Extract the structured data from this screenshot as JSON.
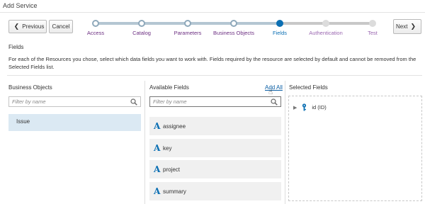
{
  "window": {
    "title": "Add Service"
  },
  "toolbar": {
    "previous_label": "Previous",
    "cancel_label": "Cancel",
    "next_label": "Next"
  },
  "train": {
    "steps": [
      {
        "label": "Access",
        "state": "visited"
      },
      {
        "label": "Catalog",
        "state": "visited"
      },
      {
        "label": "Parameters",
        "state": "visited"
      },
      {
        "label": "Business Objects",
        "state": "visited"
      },
      {
        "label": "Fields",
        "state": "current"
      },
      {
        "label": "Authentication",
        "state": "future"
      },
      {
        "label": "Test",
        "state": "future"
      }
    ]
  },
  "section": {
    "title": "Fields",
    "description": "For each of the Resources you chose, select which data fields you want to work with. Fields required by the resource are selected by default and cannot be removed from the Selected Fields list."
  },
  "business_objects": {
    "label": "Business Objects",
    "filter_placeholder": "Filter by name",
    "items": [
      "Issue"
    ]
  },
  "available_fields": {
    "label": "Available Fields",
    "add_all_label": "Add All",
    "filter_placeholder": "Filter by name",
    "type_glyph": "A",
    "items": [
      "assignee",
      "key",
      "project",
      "summary"
    ]
  },
  "selected_fields": {
    "label": "Selected Fields",
    "items": [
      "id (ID)"
    ]
  },
  "colors": {
    "accent": "#0b6fb3",
    "visited_label": "#6b2d80",
    "selected_row": "#dbe9f3",
    "field_row": "#f0f0f0"
  },
  "icons": [
    "chevron-left-icon",
    "chevron-right-icon",
    "search-icon",
    "expand-triangle-icon",
    "key-icon",
    "text-type-icon",
    "mouse-pointer-icon"
  ]
}
